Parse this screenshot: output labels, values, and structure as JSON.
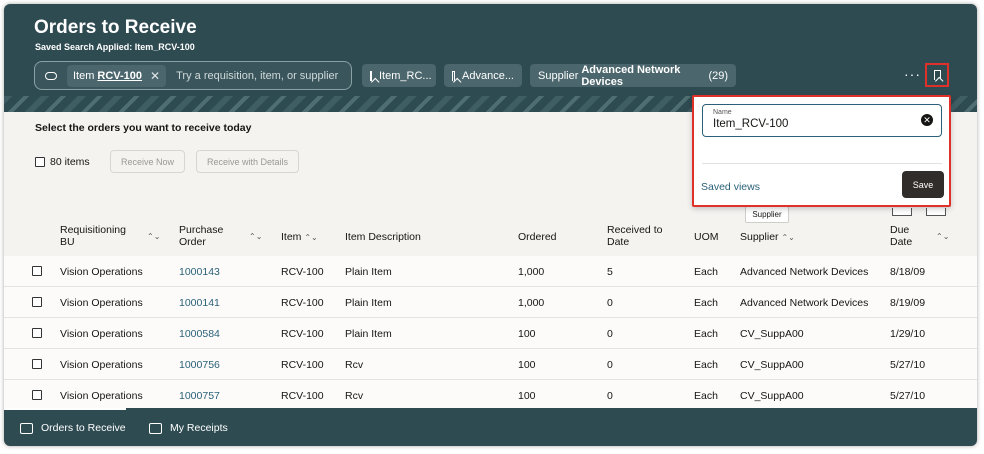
{
  "header": {
    "title": "Orders to Receive",
    "subtitle": "Saved Search Applied: Item_RCV-100",
    "search": {
      "chip_prefix": "Item",
      "chip_value": "RCV-100",
      "placeholder": "Try a requisition, item, or supplier"
    },
    "pills": [
      {
        "label": "Item_RC..."
      },
      {
        "label": "Advance..."
      },
      {
        "prefix": "Supplier",
        "value": "Advanced Network Devices",
        "count": "(29)"
      }
    ],
    "more_label": "···"
  },
  "content": {
    "prompt": "Select the orders you want to receive today",
    "item_count": "80 items",
    "receive_now": "Receive Now",
    "receive_with_details": "Receive with Details"
  },
  "table": {
    "columns": [
      "Requisitioning BU",
      "Purchase Order",
      "Item",
      "Item Description",
      "Ordered",
      "Received to Date",
      "UOM",
      "Supplier",
      "Due Date"
    ],
    "rows": [
      {
        "bu": "Vision Operations",
        "po": "1000143",
        "item": "RCV-100",
        "desc": "Plain Item",
        "ordered": "1,000",
        "received": "5",
        "uom": "Each",
        "supplier": "Advanced Network Devices",
        "due": "8/18/09"
      },
      {
        "bu": "Vision Operations",
        "po": "1000141",
        "item": "RCV-100",
        "desc": "Plain Item",
        "ordered": "1,000",
        "received": "0",
        "uom": "Each",
        "supplier": "Advanced Network Devices",
        "due": "8/19/09"
      },
      {
        "bu": "Vision Operations",
        "po": "1000584",
        "item": "RCV-100",
        "desc": "Plain Item",
        "ordered": "100",
        "received": "0",
        "uom": "Each",
        "supplier": "CV_SuppA00",
        "due": "1/29/10"
      },
      {
        "bu": "Vision Operations",
        "po": "1000756",
        "item": "RCV-100",
        "desc": "Rcv",
        "ordered": "100",
        "received": "0",
        "uom": "Each",
        "supplier": "CV_SuppA00",
        "due": "5/27/10"
      },
      {
        "bu": "Vision Operations",
        "po": "1000757",
        "item": "RCV-100",
        "desc": "Rcv",
        "ordered": "100",
        "received": "0",
        "uom": "Each",
        "supplier": "CV_SuppA00",
        "due": "5/27/10"
      }
    ]
  },
  "popup": {
    "name_label": "Name",
    "name_value": "Item_RCV-100",
    "saved_views": "Saved views",
    "save": "Save"
  },
  "tooltip": "Supplier",
  "footer": {
    "tabs": [
      "Orders to Receive",
      "My Receipts"
    ]
  },
  "colors": {
    "header": "#2f4b52",
    "accent_link": "#2a6178",
    "highlight": "#e0302a"
  }
}
